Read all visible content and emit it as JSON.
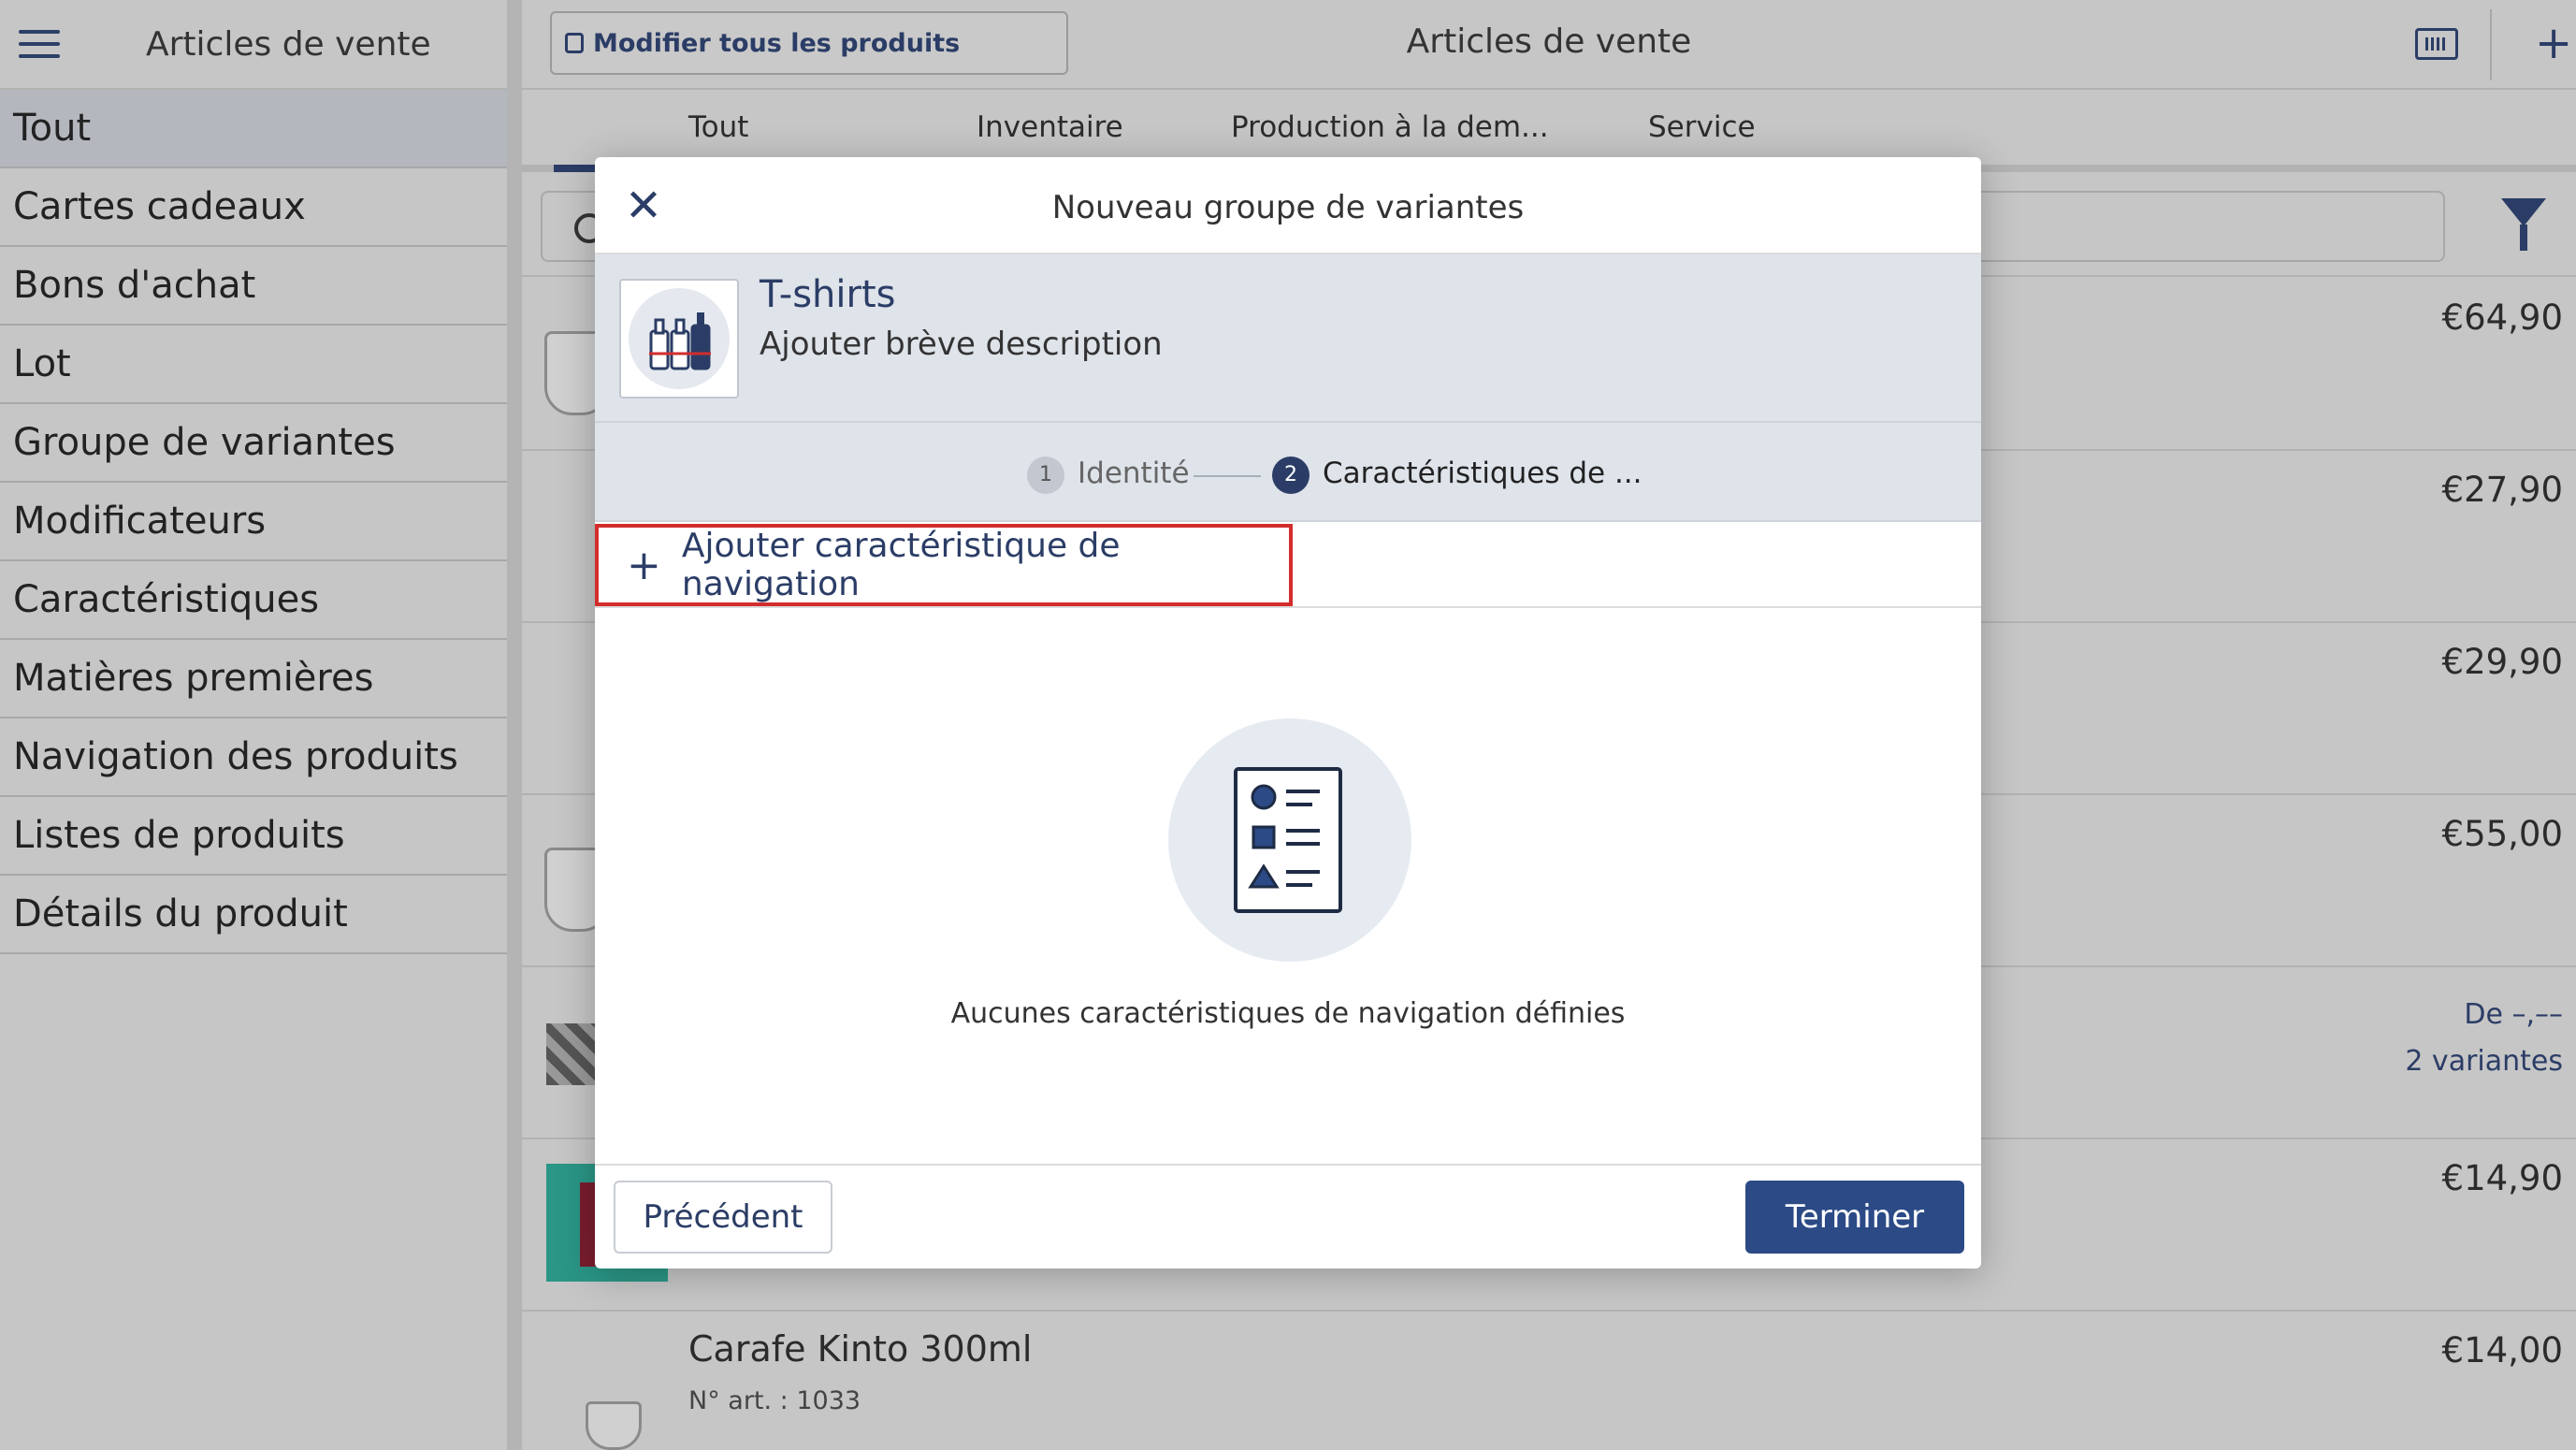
{
  "sidebar": {
    "title": "Articles de vente",
    "items": [
      {
        "label": "Tout"
      },
      {
        "label": "Cartes cadeaux"
      },
      {
        "label": "Bons d'achat"
      },
      {
        "label": "Lot"
      },
      {
        "label": "Groupe de variantes"
      },
      {
        "label": "Modificateurs"
      },
      {
        "label": "Caractéristiques"
      },
      {
        "label": "Matières premières"
      },
      {
        "label": "Navigation des produits"
      },
      {
        "label": "Listes de produits"
      },
      {
        "label": "Détails du produit"
      }
    ]
  },
  "header": {
    "edit_all_label": "Modifier tous les produits",
    "title": "Articles de vente",
    "icons": [
      "barcode-scanner-icon",
      "plus-icon"
    ]
  },
  "tabs": [
    {
      "label": "Tout"
    },
    {
      "label": "Inventaire"
    },
    {
      "label": "Production à la dem..."
    },
    {
      "label": "Service"
    }
  ],
  "products": [
    {
      "price": "€64,90"
    },
    {
      "price": "€27,90"
    },
    {
      "price": "€29,90"
    },
    {
      "price": "€55,00"
    },
    {
      "price_from": "De –,––",
      "variants": "2 variantes"
    },
    {
      "price": "€14,90"
    },
    {
      "name": "Carafe Kinto 300ml",
      "sku": "N° art. : 1033",
      "price": "€14,00"
    }
  ],
  "modal": {
    "title": "Nouveau groupe de variantes",
    "product_name": "T-shirts",
    "product_desc": "Ajouter brève description",
    "steps": [
      {
        "num": "1",
        "label": "Identité"
      },
      {
        "num": "2",
        "label": "Caractéristiques de ..."
      }
    ],
    "add_label": "Ajouter caractéristique de navigation",
    "empty_text": "Aucunes caractéristiques de navigation définies",
    "prev_label": "Précédent",
    "done_label": "Terminer"
  },
  "colors": {
    "accent": "#2b3d66",
    "primary_button": "#2b4a86",
    "highlight": "#d32d2d",
    "teal_thumb": "#2a9686"
  }
}
